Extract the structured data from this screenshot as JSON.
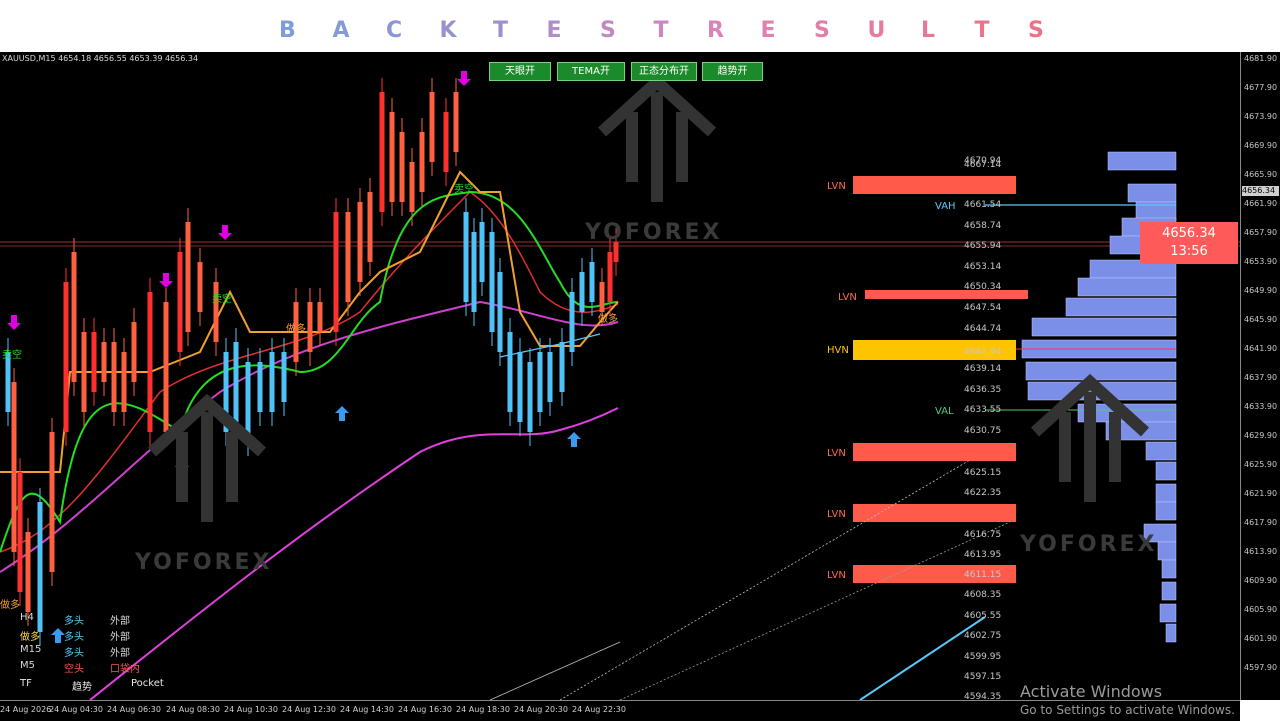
{
  "banner": {
    "letters": [
      "B",
      "A",
      "C",
      "K",
      "T",
      "E",
      "S",
      "T",
      "R",
      "E",
      "S",
      "U",
      "L",
      "T",
      "S"
    ],
    "colors": [
      "#7f9ddc",
      "#869ad8",
      "#8d96d4",
      "#9493d0",
      "#a08fcc",
      "#b08cc8",
      "#c089c4",
      "#cc86c0",
      "#d884b8",
      "#e080b0",
      "#e47da8",
      "#e67a9f",
      "#e87896",
      "#e9758d",
      "#ea7284"
    ]
  },
  "chart": {
    "symbol_info": "XAUUSD,M15  4654.18 4656.55 4653.39 4656.34",
    "watermark": "YOFOREX",
    "buttons": [
      "天眼开",
      "TEMA开",
      "正态分布开",
      "趋势开"
    ],
    "current_price": "4656.34",
    "countdown": "13:56",
    "price_tag": "4656.34",
    "profile_labels": {
      "lvn": "LVN",
      "hvn": "HVN",
      "vah": "VAH",
      "val": "VAL"
    },
    "profile_prices": [
      "4670.94",
      "4667.14",
      "4661.54",
      "4658.74",
      "4655.94",
      "4653.14",
      "4650.34",
      "4647.54",
      "4644.74",
      "4641.94",
      "4639.14",
      "4636.35",
      "4633.55",
      "4630.75",
      "4625.15",
      "4622.35",
      "4616.75",
      "4613.95",
      "4611.15",
      "4608.35",
      "4605.55",
      "4602.75",
      "4599.95",
      "4597.15",
      "4594.35"
    ],
    "axis_prices": [
      "4681.90",
      "4677.90",
      "4673.90",
      "4669.90",
      "4665.90",
      "4661.90",
      "4657.90",
      "4653.90",
      "4649.90",
      "4645.90",
      "4641.90",
      "4637.90",
      "4633.90",
      "4629.90",
      "4625.90",
      "4621.90",
      "4617.90",
      "4613.90",
      "4609.90",
      "4605.90",
      "4601.90",
      "4597.90"
    ],
    "time_labels": [
      "24 Aug 2026",
      "24 Aug 04:30",
      "24 Aug 06:30",
      "24 Aug 08:30",
      "24 Aug 10:30",
      "24 Aug 12:30",
      "24 Aug 14:30",
      "24 Aug 16:30",
      "24 Aug 18:30",
      "24 Aug 20:30",
      "24 Aug 22:30"
    ],
    "signal_labels": {
      "sell": "卖空",
      "buy": "做多"
    },
    "trend_table": {
      "rows": [
        {
          "tf": "H4",
          "trend": "多头",
          "pocket": "外部",
          "trend_color": "#5ac8fa",
          "pocket_color": "#d8d8d8"
        },
        {
          "tf": "做多",
          "trend": "多头",
          "pocket": "外部",
          "trend_color": "#5ac8fa",
          "pocket_color": "#d8d8d8"
        },
        {
          "tf": "M15",
          "trend": "多头",
          "pocket": "外部",
          "trend_color": "#5ac8fa",
          "pocket_color": "#d8d8d8"
        },
        {
          "tf": "M5",
          "trend": "空头",
          "pocket": "口袋内",
          "trend_color": "#ff5a4a",
          "pocket_color": "#ff5a4a"
        }
      ],
      "header": {
        "tf": "TF",
        "trend": "趋势",
        "pocket": "Pocket"
      }
    }
  },
  "activate": {
    "title": "Activate Windows",
    "subtitle": "Go to Settings to activate Windows."
  }
}
